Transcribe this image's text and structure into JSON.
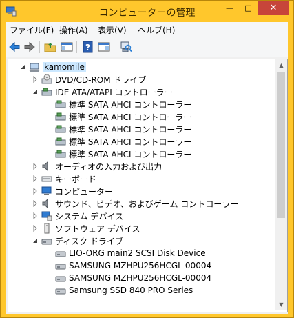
{
  "window": {
    "title": "コンピューターの管理"
  },
  "menu": [
    "ファイル(F)",
    "操作(A)",
    "表示(V)",
    "ヘルプ(H)"
  ],
  "toolbar_icons": [
    "back-arrow-icon",
    "forward-arrow-icon",
    "up-folder-icon",
    "show-hide-console-tree-icon",
    "help-icon",
    "properties-icon",
    "scan-hardware-icon"
  ],
  "tree": {
    "root": "kamomile",
    "items": [
      {
        "label": "DVD/CD-ROM ドライブ",
        "icon": "dvd-drive-icon",
        "expanded": false,
        "level": 1
      },
      {
        "label": "IDE ATA/ATAPI コントローラー",
        "icon": "ide-controller-icon",
        "expanded": true,
        "level": 1
      },
      {
        "label": "標準 SATA AHCI コントローラー",
        "icon": "ide-controller-icon",
        "level": 2
      },
      {
        "label": "標準 SATA AHCI コントローラー",
        "icon": "ide-controller-icon",
        "level": 2
      },
      {
        "label": "標準 SATA AHCI コントローラー",
        "icon": "ide-controller-icon",
        "level": 2
      },
      {
        "label": "標準 SATA AHCI コントローラー",
        "icon": "ide-controller-icon",
        "level": 2
      },
      {
        "label": "標準 SATA AHCI コントローラー",
        "icon": "ide-controller-icon",
        "level": 2
      },
      {
        "label": "オーディオの入力および出力",
        "icon": "speaker-icon",
        "expanded": false,
        "level": 1
      },
      {
        "label": "キーボード",
        "icon": "keyboard-icon",
        "expanded": false,
        "level": 1
      },
      {
        "label": "コンピューター",
        "icon": "computer-icon",
        "expanded": false,
        "level": 1
      },
      {
        "label": "サウンド、ビデオ、およびゲーム コントローラー",
        "icon": "speaker-icon",
        "expanded": false,
        "level": 1
      },
      {
        "label": "システム デバイス",
        "icon": "system-device-icon",
        "expanded": false,
        "level": 1
      },
      {
        "label": "ソフトウェア デバイス",
        "icon": "software-device-icon",
        "expanded": false,
        "level": 1
      },
      {
        "label": "ディスク ドライブ",
        "icon": "disk-drive-icon",
        "expanded": true,
        "level": 1
      },
      {
        "label": "LIO-ORG main2 SCSI Disk Device",
        "icon": "disk-drive-icon",
        "level": 2
      },
      {
        "label": "SAMSUNG MZHPU256HCGL-00004",
        "icon": "disk-drive-icon",
        "level": 2
      },
      {
        "label": "SAMSUNG MZHPU256HCGL-00004",
        "icon": "disk-drive-icon",
        "level": 2
      },
      {
        "label": "Samsung SSD 840 PRO Series",
        "icon": "disk-drive-icon",
        "level": 2
      }
    ]
  },
  "colors": {
    "titlebar": "#ffc72c",
    "close": "#c7453a",
    "selection": "#cce8ff"
  }
}
